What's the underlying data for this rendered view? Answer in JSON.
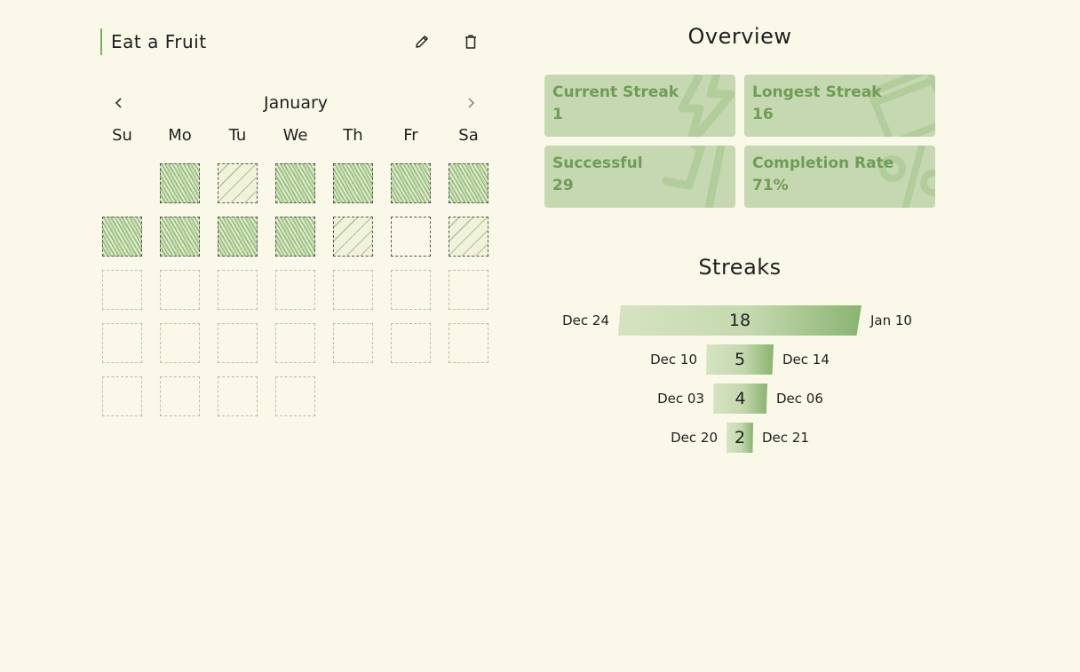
{
  "habit": {
    "title": "Eat a Fruit"
  },
  "calendar": {
    "month": "January",
    "weekdays": [
      "Su",
      "Mo",
      "Tu",
      "We",
      "Th",
      "Fr",
      "Sa"
    ],
    "days": [
      {
        "status": "blank"
      },
      {
        "status": "full"
      },
      {
        "status": "partial"
      },
      {
        "status": "full"
      },
      {
        "status": "full"
      },
      {
        "status": "full"
      },
      {
        "status": "full"
      },
      {
        "status": "full"
      },
      {
        "status": "full"
      },
      {
        "status": "full"
      },
      {
        "status": "full"
      },
      {
        "status": "partial"
      },
      {
        "status": "none"
      },
      {
        "status": "partial"
      },
      {
        "status": "empty"
      },
      {
        "status": "empty"
      },
      {
        "status": "empty"
      },
      {
        "status": "empty"
      },
      {
        "status": "empty"
      },
      {
        "status": "empty"
      },
      {
        "status": "empty"
      },
      {
        "status": "empty"
      },
      {
        "status": "empty"
      },
      {
        "status": "empty"
      },
      {
        "status": "empty"
      },
      {
        "status": "empty"
      },
      {
        "status": "empty"
      },
      {
        "status": "empty"
      },
      {
        "status": "empty"
      },
      {
        "status": "empty"
      },
      {
        "status": "empty"
      },
      {
        "status": "empty"
      }
    ]
  },
  "overview": {
    "title": "Overview",
    "cards": [
      {
        "label": "Current Streak",
        "value": "1",
        "icon": "lightning-icon"
      },
      {
        "label": "Longest Streak",
        "value": "16",
        "icon": "calendar-icon"
      },
      {
        "label": "Successful",
        "value": "29",
        "icon": "check-icon"
      },
      {
        "label": "Completion Rate",
        "value": "71%",
        "icon": "percent-icon"
      }
    ]
  },
  "streaks": {
    "title": "Streaks",
    "items": [
      {
        "start": "Dec 24",
        "end": "Jan 10",
        "length": 18
      },
      {
        "start": "Dec 10",
        "end": "Dec 14",
        "length": 5
      },
      {
        "start": "Dec 03",
        "end": "Dec 06",
        "length": 4
      },
      {
        "start": "Dec 20",
        "end": "Dec 21",
        "length": 2
      }
    ]
  },
  "colors": {
    "background": "#faf8e8",
    "accent": "#7fae62",
    "card": "#c5d8b2",
    "card_text": "#6f9c56"
  }
}
